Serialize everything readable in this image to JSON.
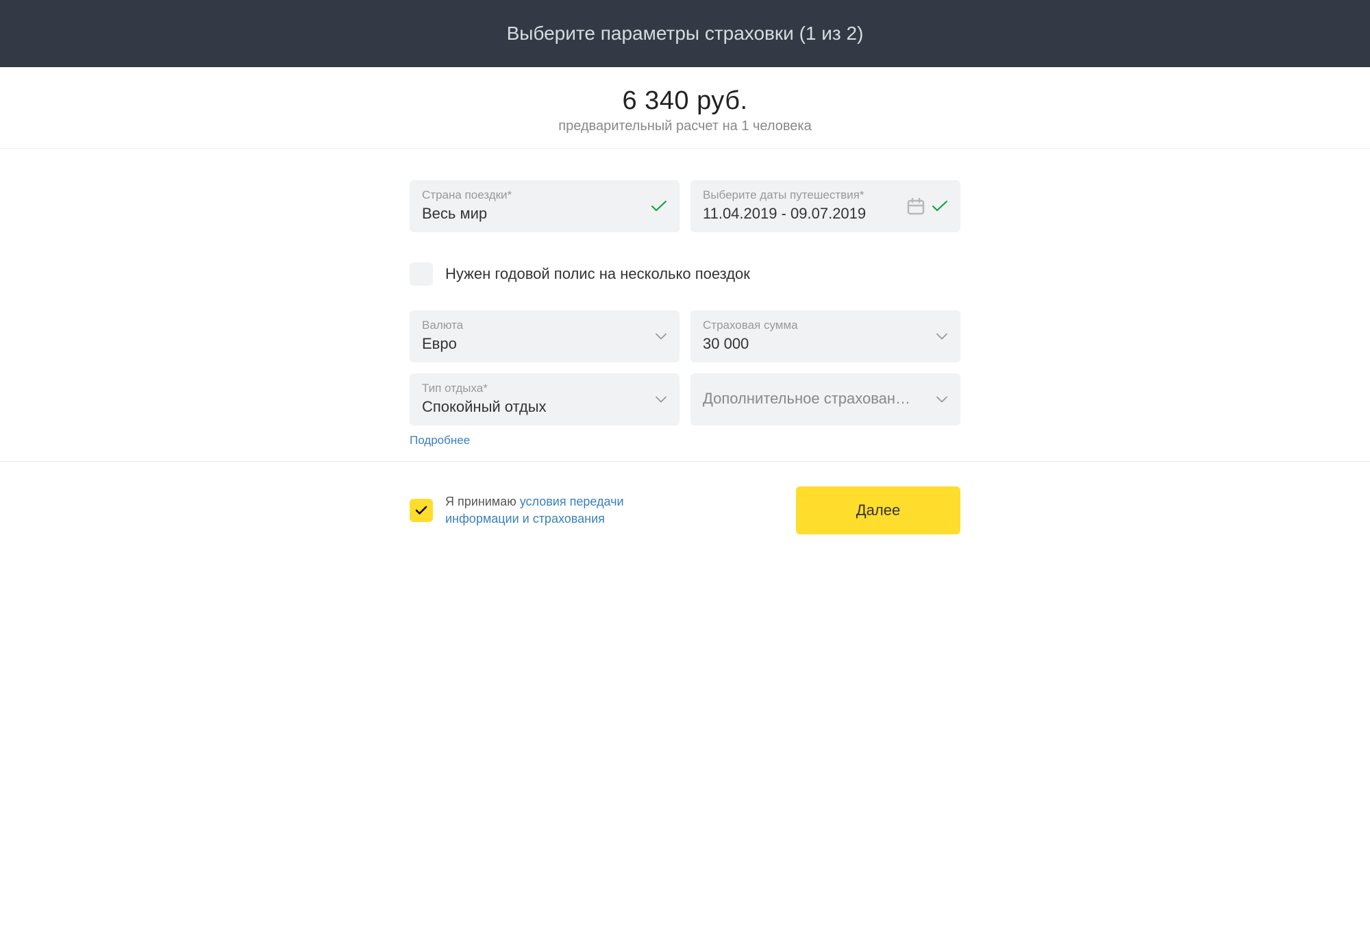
{
  "header": {
    "title": "Выберите параметры страховки (1 из 2)"
  },
  "price": {
    "amount": "6 340 руб.",
    "subtitle": "предварительный расчет на 1 человека"
  },
  "fields": {
    "country": {
      "label": "Страна поездки*",
      "value": "Весь мир"
    },
    "dates": {
      "label": "Выберите даты путешествия*",
      "value": "11.04.2019 - 09.07.2019"
    },
    "annual_policy": {
      "label": "Нужен годовой полис на несколько поездок"
    },
    "currency": {
      "label": "Валюта",
      "value": "Евро"
    },
    "coverage": {
      "label": "Страховая сумма",
      "value": "30 000"
    },
    "vacation_type": {
      "label": "Тип отдыха*",
      "value": "Спокойный отдых"
    },
    "additional": {
      "placeholder": "Дополнительное страхован…"
    }
  },
  "more_link": "Подробнее",
  "agreement": {
    "prefix": "Я принимаю ",
    "link_text": "условия передачи информации и страхования"
  },
  "next_button": "Далее"
}
